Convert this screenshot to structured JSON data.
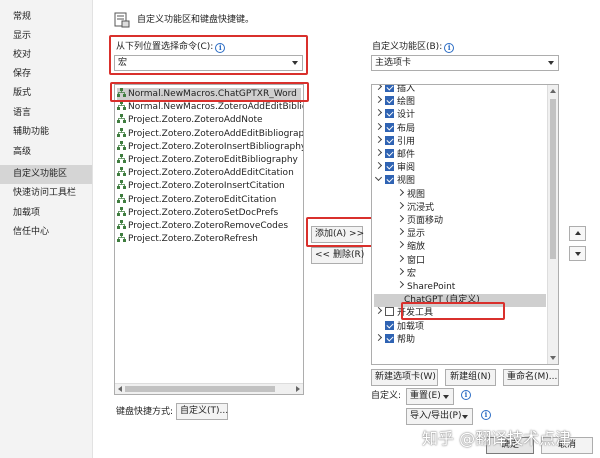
{
  "nav": {
    "items": [
      "常规",
      "显示",
      "校对",
      "保存",
      "版式",
      "语言",
      "辅助功能",
      "高级",
      "自定义功能区",
      "快速访问工具栏",
      "加载项",
      "信任中心"
    ],
    "selected_index": 8
  },
  "header": {
    "title": "自定义功能区和键盘快捷键。"
  },
  "commands": {
    "label": "从下列位置选择命令(C):",
    "source_value": "宏",
    "items": [
      "Normal.NewMacros.ChatGPTXR_Word",
      "Normal.NewMacros.ZoteroAddEditBibliogr",
      "Project.Zotero.ZoteroAddNote",
      "Project.Zotero.ZoteroAddEditBibliography",
      "Project.Zotero.ZoteroInsertBibliography",
      "Project.Zotero.ZoteroEditBibliography",
      "Project.Zotero.ZoteroAddEditCitation",
      "Project.Zotero.ZoteroInsertCitation",
      "Project.Zotero.ZoteroEditCitation",
      "Project.Zotero.ZoteroSetDocPrefs",
      "Project.Zotero.ZoteroRemoveCodes",
      "Project.Zotero.ZoteroRefresh"
    ],
    "selected_index": 0
  },
  "middle": {
    "add_label": "添加(A) >>",
    "remove_label": "<< 删除(R)"
  },
  "ribbon": {
    "label": "自定义功能区(B):",
    "tabs_value": "主选项卡",
    "tree": [
      {
        "text": "插入",
        "level": 0,
        "expander": "right",
        "checkbox": true
      },
      {
        "text": "绘图",
        "level": 0,
        "expander": "right",
        "checkbox": true
      },
      {
        "text": "设计",
        "level": 0,
        "expander": "right",
        "checkbox": true
      },
      {
        "text": "布局",
        "level": 0,
        "expander": "right",
        "checkbox": true
      },
      {
        "text": "引用",
        "level": 0,
        "expander": "right",
        "checkbox": true
      },
      {
        "text": "邮件",
        "level": 0,
        "expander": "right",
        "checkbox": true
      },
      {
        "text": "审阅",
        "level": 0,
        "expander": "right",
        "checkbox": true
      },
      {
        "text": "视图",
        "level": 0,
        "expander": "down",
        "checkbox": true
      },
      {
        "text": "视图",
        "level": 1,
        "expander": "right",
        "checkbox": false
      },
      {
        "text": "沉浸式",
        "level": 1,
        "expander": "right",
        "checkbox": false
      },
      {
        "text": "页面移动",
        "level": 1,
        "expander": "right",
        "checkbox": false
      },
      {
        "text": "显示",
        "level": 1,
        "expander": "right",
        "checkbox": false
      },
      {
        "text": "缩放",
        "level": 1,
        "expander": "right",
        "checkbox": false
      },
      {
        "text": "窗口",
        "level": 1,
        "expander": "right",
        "checkbox": false
      },
      {
        "text": "宏",
        "level": 1,
        "expander": "right",
        "checkbox": false
      },
      {
        "text": "SharePoint",
        "level": 1,
        "expander": "right",
        "checkbox": false
      },
      {
        "text": "ChatGPT (自定义)",
        "level": 2,
        "expander": "none",
        "checkbox": false
      },
      {
        "text": "开发工具",
        "level": 0,
        "expander": "right",
        "checkbox": "unchecked"
      },
      {
        "text": "加载项",
        "level": 0,
        "expander": "none",
        "checkbox": true
      },
      {
        "text": "帮助",
        "level": 0,
        "expander": "right",
        "checkbox": true
      }
    ],
    "selected_index": 16
  },
  "actions": {
    "new_tab_label": "新建选项卡(W)",
    "new_group_label": "新建组(N)",
    "rename_label": "重命名(M)...",
    "customize_label": "自定义:",
    "reset_label": "重置(E)",
    "import_export_label": "导入/导出(P)"
  },
  "keyboard": {
    "label": "键盘快捷方式:",
    "button_label": "自定义(T)..."
  },
  "footer": {
    "ok_label": "确定",
    "cancel_label": "取消"
  },
  "watermark": "知乎 @翻译技术点津",
  "colors": {
    "highlight_red": "#d9302c",
    "checkbox_blue": "#2f63b3",
    "info_blue": "#2b6cc4"
  }
}
